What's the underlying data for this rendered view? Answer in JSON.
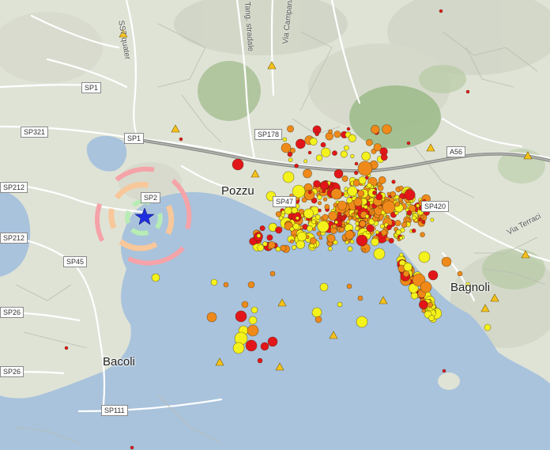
{
  "map": {
    "places": [
      {
        "name": "Pozzuoli",
        "text": "Pozzu"
      },
      {
        "name": "Bagnoli",
        "text": "Bagnoli"
      },
      {
        "name": "Bacoli",
        "text": "Bacoli"
      }
    ],
    "streets": [
      {
        "name": "quater",
        "text": "SS7 quater"
      },
      {
        "name": "stradale",
        "text": "Tang. stradale"
      },
      {
        "name": "campana",
        "text": "Via Campana"
      },
      {
        "name": "terracina",
        "text": "Via Terraci"
      }
    ],
    "road_labels": [
      {
        "name": "sp1-top",
        "text": "SP1"
      },
      {
        "name": "sp321",
        "text": "SP321"
      },
      {
        "name": "sp1-mid",
        "text": "SP1"
      },
      {
        "name": "sp178",
        "text": "SP178"
      },
      {
        "name": "a56",
        "text": "A56"
      },
      {
        "name": "sp212-a",
        "text": "SP212"
      },
      {
        "name": "sp2",
        "text": "SP2"
      },
      {
        "name": "sp212-b",
        "text": "SP212"
      },
      {
        "name": "sp47",
        "text": "SP47"
      },
      {
        "name": "sp420",
        "text": "SP420"
      },
      {
        "name": "sp45",
        "text": "SP45"
      },
      {
        "name": "sp26-a",
        "text": "SP26"
      },
      {
        "name": "sp26-b",
        "text": "SP26"
      },
      {
        "name": "sp111",
        "text": "SP111"
      }
    ],
    "colors": {
      "sea": "#a9c3dc",
      "land": "#dfe3d6",
      "crater": "#a9c195",
      "quake_red": "#e2161a",
      "quake_orange": "#ef8a1a",
      "quake_yellow": "#f4f21c",
      "station": "#f6c21a",
      "epicenter_star": "#2030e0"
    }
  }
}
